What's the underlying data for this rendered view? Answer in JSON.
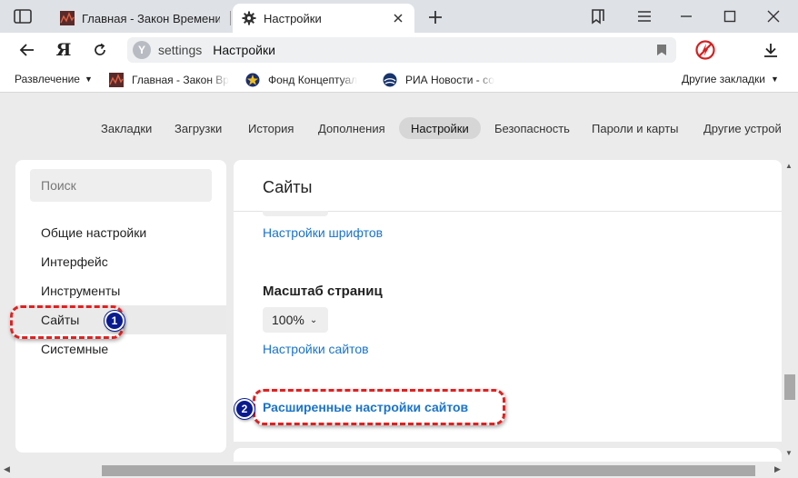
{
  "tabs": [
    {
      "title": "Главная - Закон Времени"
    },
    {
      "title": "Настройки"
    }
  ],
  "address": {
    "url": "settings",
    "page_title": "Настройки"
  },
  "bookmarks": {
    "folder": "Развлечение",
    "items": [
      {
        "text": "Главная - Закон Вр"
      },
      {
        "text": "Фонд Концептуал"
      },
      {
        "text": "РИА Новости - со"
      }
    ],
    "other": "Другие закладки"
  },
  "settings_nav": [
    {
      "label": "Закладки"
    },
    {
      "label": "Загрузки"
    },
    {
      "label": "История"
    },
    {
      "label": "Дополнения"
    },
    {
      "label": "Настройки"
    },
    {
      "label": "Безопасность"
    },
    {
      "label": "Пароли и карты"
    },
    {
      "label": "Другие устрой"
    }
  ],
  "sidebar": {
    "search_placeholder": "Поиск",
    "items": [
      {
        "label": "Общие настройки"
      },
      {
        "label": "Интерфейс"
      },
      {
        "label": "Инструменты"
      },
      {
        "label": "Сайты"
      },
      {
        "label": "Системные"
      }
    ]
  },
  "content": {
    "header": "Сайты",
    "font_settings_link": "Настройки шрифтов",
    "zoom_title": "Масштаб страниц",
    "zoom_value": "100%",
    "site_settings_link": "Настройки сайтов",
    "advanced_link": "Расширенные настройки сайтов"
  },
  "annotations": {
    "badge1": "1",
    "badge2": "2"
  },
  "colors": {
    "link": "#1a73c9",
    "annotation_ring": "#e32020",
    "annotation_badge": "#0a1b8f"
  }
}
